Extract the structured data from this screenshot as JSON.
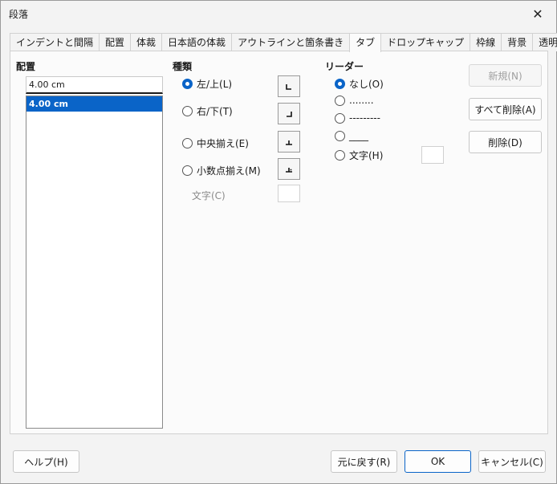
{
  "window": {
    "title": "段落",
    "close_glyph": "✕"
  },
  "tabs": [
    {
      "label": "インデントと間隔"
    },
    {
      "label": "配置"
    },
    {
      "label": "体裁"
    },
    {
      "label": "日本語の体裁"
    },
    {
      "label": "アウトラインと箇条書き"
    },
    {
      "label": "タブ",
      "active": true
    },
    {
      "label": "ドロップキャップ"
    },
    {
      "label": "枠線"
    },
    {
      "label": "背景"
    },
    {
      "label": "透明"
    }
  ],
  "position": {
    "heading": "配置",
    "input_value": "4.00 cm",
    "items": [
      "4.00 cm"
    ]
  },
  "type": {
    "heading": "種類",
    "options": [
      {
        "label": "左/上(L)",
        "checked": true
      },
      {
        "label": "右/下(T)",
        "checked": false
      },
      {
        "label": "中央揃え(E)",
        "checked": false
      },
      {
        "label": "小数点揃え(M)",
        "checked": false
      }
    ],
    "char_label": "文字(C)"
  },
  "leader": {
    "heading": "リーダー",
    "options": [
      {
        "label": "なし(O)",
        "checked": true
      },
      {
        "label": "........",
        "checked": false
      },
      {
        "label": "---------",
        "checked": false
      },
      {
        "label": "____",
        "checked": false
      },
      {
        "label": "文字(H)",
        "checked": false
      }
    ]
  },
  "actions": {
    "new_label": "新規(N)",
    "delete_all_label": "すべて削除(A)",
    "delete_label": "削除(D)"
  },
  "footer": {
    "help_label": "ヘルプ(H)",
    "reset_label": "元に戻す(R)",
    "ok_label": "OK",
    "cancel_label": "キャンセル(C)"
  },
  "colors": {
    "accent": "#0a64c8"
  }
}
